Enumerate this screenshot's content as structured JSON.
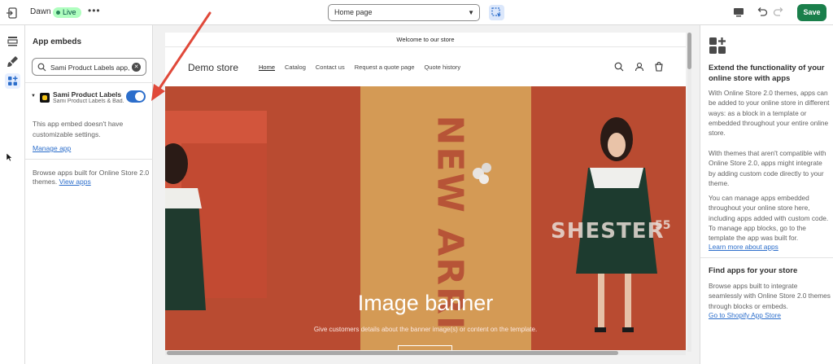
{
  "topbar": {
    "theme_name": "Dawn",
    "status_badge": "Live",
    "more_label": "•••",
    "page_select": "Home page",
    "save_label": "Save"
  },
  "panel": {
    "title": "App embeds",
    "search_value": "Sami Product Labels app,",
    "embed": {
      "name": "Sami Product Labels",
      "subtitle": "Sami Product Labels & Bad...",
      "enabled": true
    },
    "note": "This app embed doesn't have customizable settings.",
    "manage_link": "Manage app",
    "browse_text": "Browse apps built for Online Store 2.0 themes.",
    "view_apps_link": "View apps"
  },
  "preview": {
    "announcement": "Welcome to our store",
    "store_name": "Demo store",
    "nav": [
      "Home",
      "Catalog",
      "Contact us",
      "Request a quote page",
      "Quote history"
    ],
    "nav_active": "Home",
    "banner_title": "Image banner",
    "banner_subtitle": "Give customers details about the banner image(s) or content on the template.",
    "banner_art_text_1": "NEW ARRI",
    "banner_art_text_2": "SHESTER",
    "banner_art_text_3": "55"
  },
  "right_panel": {
    "title": "Extend the functionality of your online store with apps",
    "p1": "With Online Store 2.0 themes, apps can be added to your online store in different ways: as a block in a template or embedded throughout your entire online store.",
    "p2": "With themes that aren't compatible with Online Store 2.0, apps might integrate by adding custom code directly to your theme.",
    "p3": "You can manage apps embedded throughout your online store here, including apps added with custom code. To manage app blocks, go to the template the app was built for.",
    "learn_more_link": "Learn more about apps",
    "find_title": "Find apps for your store",
    "find_text": "Browse apps built to integrate seamlessly with Online Store 2.0 themes through blocks or embeds.",
    "store_link": "Go to Shopify App Store"
  },
  "colors": {
    "accent": "#2c6ecb",
    "save": "#1a7f4b",
    "live_badge": "#affebf",
    "annotation_arrow": "#e0493a"
  }
}
